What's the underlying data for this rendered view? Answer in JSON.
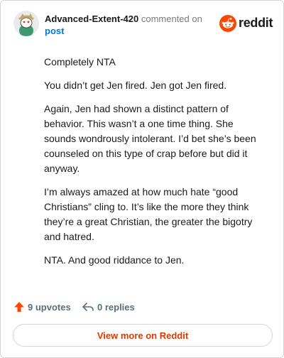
{
  "header": {
    "username": "Advanced-Extent-420",
    "commented_text": "commented on",
    "post_link": "post",
    "brand": "reddit"
  },
  "comment": {
    "paragraphs": [
      "Completely NTA",
      "You didn’t get Jen fired. Jen got Jen fired.",
      "Again, Jen had shown a distinct pattern of behavior. This wasn’t a one time thing. She sounds wondrously intolerant. I’d bet she’s been counseled on this type of crap before but did it anyway.",
      "I’m always amazed at how much hate “good Christians” cling to. It’s like the more they think they’re a great Christian, the greater the bigotry and hatred.",
      "NTA. And good riddance to Jen."
    ]
  },
  "actions": {
    "upvotes": "9 upvotes",
    "replies": "0 replies"
  },
  "footer": {
    "view_more": "View more on Reddit"
  },
  "colors": {
    "accent": "#d93a00",
    "link": "#0079d3",
    "upvote": "#ff4500"
  },
  "icons": [
    "reddit-snoo-avatar-icon",
    "reddit-logo-icon",
    "upvote-arrow-icon",
    "reply-arrow-icon"
  ]
}
